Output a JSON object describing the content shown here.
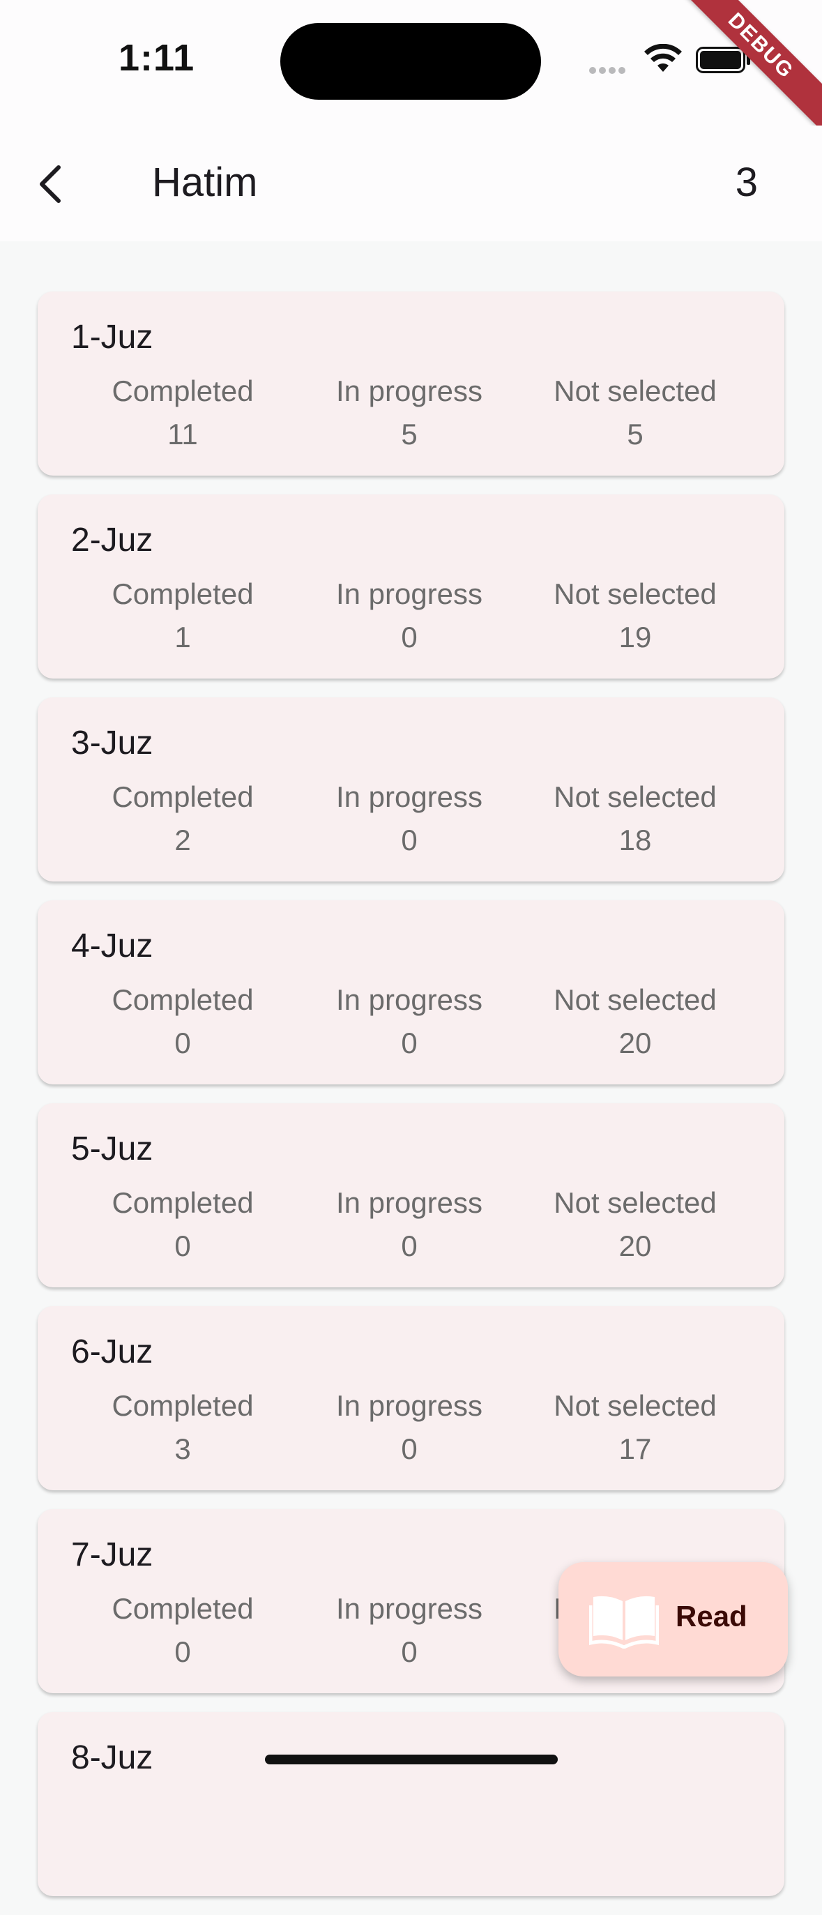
{
  "status": {
    "time": "1:11"
  },
  "debug_label": "DEBUG",
  "app_bar": {
    "title": "Hatim",
    "count": "3"
  },
  "juz_items": [
    {
      "title": "1-Juz",
      "completed_label": "Completed",
      "completed": "11",
      "in_progress_label": "In progress",
      "in_progress": "5",
      "not_selected_label": "Not selected",
      "not_selected": "5"
    },
    {
      "title": "2-Juz",
      "completed_label": "Completed",
      "completed": "1",
      "in_progress_label": "In progress",
      "in_progress": "0",
      "not_selected_label": "Not selected",
      "not_selected": "19"
    },
    {
      "title": "3-Juz",
      "completed_label": "Completed",
      "completed": "2",
      "in_progress_label": "In progress",
      "in_progress": "0",
      "not_selected_label": "Not selected",
      "not_selected": "18"
    },
    {
      "title": "4-Juz",
      "completed_label": "Completed",
      "completed": "0",
      "in_progress_label": "In progress",
      "in_progress": "0",
      "not_selected_label": "Not selected",
      "not_selected": "20"
    },
    {
      "title": "5-Juz",
      "completed_label": "Completed",
      "completed": "0",
      "in_progress_label": "In progress",
      "in_progress": "0",
      "not_selected_label": "Not selected",
      "not_selected": "20"
    },
    {
      "title": "6-Juz",
      "completed_label": "Completed",
      "completed": "3",
      "in_progress_label": "In progress",
      "in_progress": "0",
      "not_selected_label": "Not selected",
      "not_selected": "17"
    },
    {
      "title": "7-Juz",
      "completed_label": "Completed",
      "completed": "0",
      "in_progress_label": "In progress",
      "in_progress": "0",
      "not_selected_label": "Not selected",
      "not_selected": ""
    },
    {
      "title": "8-Juz",
      "completed_label": "",
      "completed": "",
      "in_progress_label": "",
      "in_progress": "",
      "not_selected_label": "",
      "not_selected": ""
    }
  ],
  "fab": {
    "label": "Read",
    "icon": "open-book-icon"
  },
  "icons": {
    "back": "arrow-back-icon",
    "wifi": "wifi-icon",
    "battery": "battery-icon",
    "signal": "cellular-signal-icon"
  },
  "colors": {
    "card_background": "#f9eff0",
    "fab_background": "#ffdad4",
    "debug_banner": "#b0323d"
  }
}
